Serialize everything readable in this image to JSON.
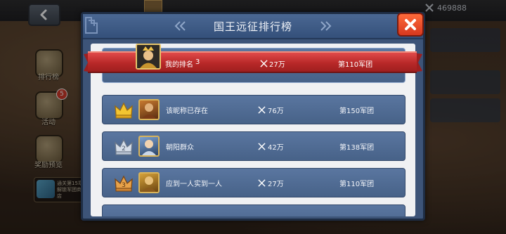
{
  "topbar": {
    "resource_amount": "469888",
    "resource_icon": "crossed-swords-icon"
  },
  "side_menu": [
    {
      "label": "排行榜",
      "badge": ""
    },
    {
      "label": "活动",
      "badge": "5"
    },
    {
      "label": "奖励预览",
      "badge": ""
    }
  ],
  "notice": {
    "text": "通关第15章解锁军团商店"
  },
  "dialog": {
    "title": "国王远征排行榜",
    "close_icon": "close-x-icon",
    "my_rank": {
      "label": "我的排名",
      "rank": "3",
      "power": "27万",
      "legion": "第110军团"
    },
    "rows": [
      {
        "rank": "1",
        "medal": "gold-crown-icon",
        "name": "该昵称已存在",
        "power": "76万",
        "legion": "第150军团"
      },
      {
        "rank": "2",
        "medal": "silver-crown-icon",
        "name": "朝阳群众",
        "power": "42万",
        "legion": "第138军团"
      },
      {
        "rank": "3",
        "medal": "bronze-crown-icon",
        "name": "应到一人实到一人",
        "power": "27万",
        "legion": "第110军团"
      }
    ]
  },
  "colors": {
    "ribbon": "#c43030",
    "dialog": "#3d5478",
    "row": "#4f6b94",
    "close": "#e24a28"
  }
}
